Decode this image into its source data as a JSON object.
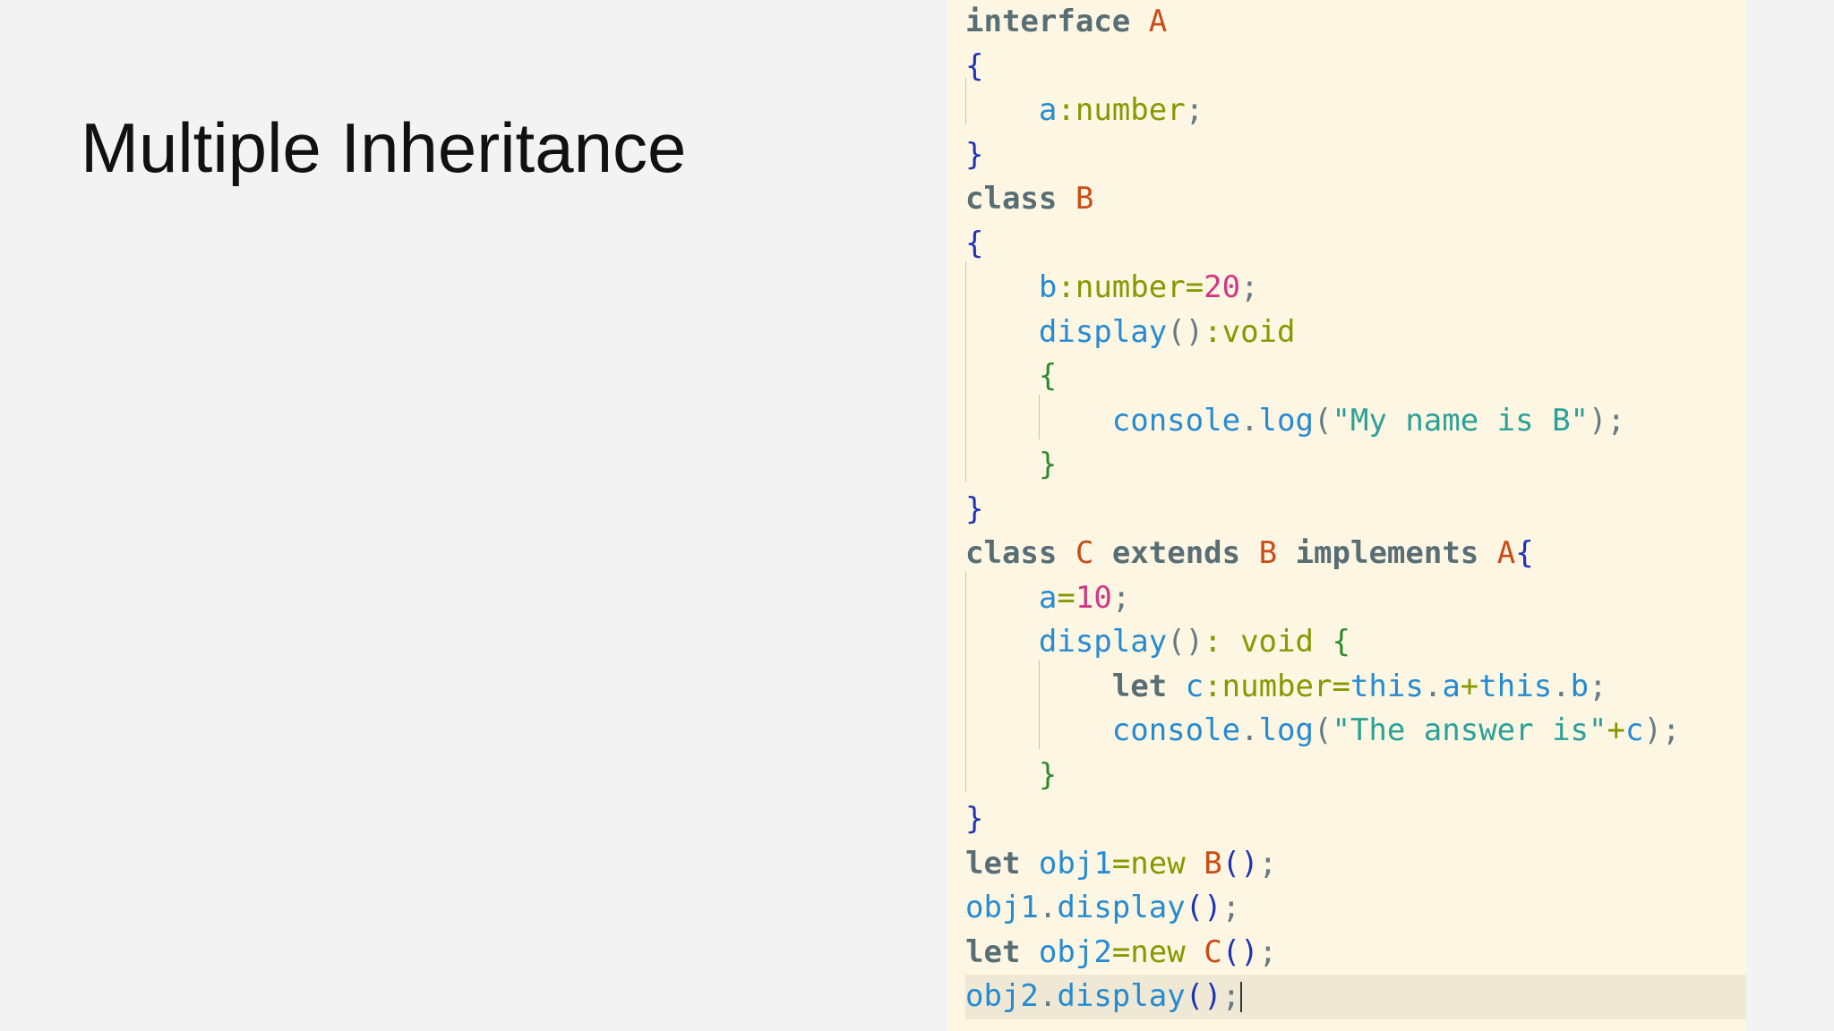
{
  "slide": {
    "title": "Multiple Inheritance"
  },
  "colors": {
    "slide_background": "#f3f3f3",
    "editor_background": "#fdf6e3",
    "current_line_background": "#efe8d4",
    "keyword": "#586e75",
    "type": "#859900",
    "identifier_name": "#cb4b16",
    "brace": "#2033b8",
    "inner_brace": "#2e8b2e",
    "property": "#268bd2",
    "number": "#d33682",
    "string": "#2aa198"
  },
  "editor": {
    "current_line": 23,
    "lines": [
      [
        [
          "kw",
          "interface"
        ],
        [
          "pu",
          " "
        ],
        [
          "nm",
          "A"
        ]
      ],
      [
        [
          "br",
          "{"
        ]
      ],
      [
        [
          "pu",
          "    "
        ],
        [
          "pr",
          "a"
        ],
        [
          "ty",
          ":number"
        ],
        [
          "pu",
          ";"
        ]
      ],
      [
        [
          "br",
          "}"
        ]
      ],
      [
        [
          "kw",
          "class"
        ],
        [
          "pu",
          " "
        ],
        [
          "nm",
          "B"
        ]
      ],
      [
        [
          "br",
          "{"
        ]
      ],
      [
        [
          "pu",
          "    "
        ],
        [
          "pr",
          "b"
        ],
        [
          "ty",
          ":number"
        ],
        [
          "op",
          "="
        ],
        [
          "num",
          "20"
        ],
        [
          "pu",
          ";"
        ]
      ],
      [
        [
          "pu",
          "    "
        ],
        [
          "fn",
          "display"
        ],
        [
          "pu",
          "()"
        ],
        [
          "ty",
          ":void"
        ]
      ],
      [
        [
          "pu",
          "    "
        ],
        [
          "br2",
          "{"
        ]
      ],
      [
        [
          "pu",
          "        "
        ],
        [
          "fn",
          "console"
        ],
        [
          "pu",
          "."
        ],
        [
          "fn",
          "log"
        ],
        [
          "pu",
          "("
        ],
        [
          "str",
          "\"My name is B\""
        ],
        [
          "pu",
          ");"
        ]
      ],
      [
        [
          "pu",
          "    "
        ],
        [
          "br2",
          "}"
        ]
      ],
      [
        [
          "br",
          "}"
        ]
      ],
      [
        [
          "kw",
          "class"
        ],
        [
          "pu",
          " "
        ],
        [
          "nm",
          "C"
        ],
        [
          "pu",
          " "
        ],
        [
          "kw",
          "extends"
        ],
        [
          "pu",
          " "
        ],
        [
          "nm",
          "B"
        ],
        [
          "pu",
          " "
        ],
        [
          "kw",
          "implements"
        ],
        [
          "pu",
          " "
        ],
        [
          "nm",
          "A"
        ],
        [
          "br",
          "{"
        ]
      ],
      [
        [
          "pu",
          "    "
        ],
        [
          "pr",
          "a"
        ],
        [
          "op",
          "="
        ],
        [
          "num",
          "10"
        ],
        [
          "pu",
          ";"
        ]
      ],
      [
        [
          "pu",
          "    "
        ],
        [
          "fn",
          "display"
        ],
        [
          "pu",
          "()"
        ],
        [
          "ty",
          ": void"
        ],
        [
          "pu",
          " "
        ],
        [
          "br2",
          "{"
        ]
      ],
      [
        [
          "pu",
          "        "
        ],
        [
          "kw",
          "let"
        ],
        [
          "pu",
          " "
        ],
        [
          "pr",
          "c"
        ],
        [
          "ty",
          ":number"
        ],
        [
          "op",
          "="
        ],
        [
          "fn",
          "this"
        ],
        [
          "pu",
          "."
        ],
        [
          "pr",
          "a"
        ],
        [
          "op",
          "+"
        ],
        [
          "fn",
          "this"
        ],
        [
          "pu",
          "."
        ],
        [
          "pr",
          "b"
        ],
        [
          "pu",
          ";"
        ]
      ],
      [
        [
          "pu",
          "        "
        ],
        [
          "fn",
          "console"
        ],
        [
          "pu",
          "."
        ],
        [
          "fn",
          "log"
        ],
        [
          "pu",
          "("
        ],
        [
          "str",
          "\"The answer is\""
        ],
        [
          "op",
          "+"
        ],
        [
          "pr",
          "c"
        ],
        [
          "pu",
          ");"
        ]
      ],
      [
        [
          "pu",
          "    "
        ],
        [
          "br2",
          "}"
        ]
      ],
      [
        [
          "br",
          "}"
        ]
      ],
      [
        [
          "kw",
          "let"
        ],
        [
          "pu",
          " "
        ],
        [
          "pr",
          "obj1"
        ],
        [
          "op",
          "="
        ],
        [
          "ty",
          "new"
        ],
        [
          "pu",
          " "
        ],
        [
          "nm",
          "B"
        ],
        [
          "br",
          "()"
        ],
        [
          "pu",
          ";"
        ]
      ],
      [
        [
          "pr",
          "obj1"
        ],
        [
          "pu",
          "."
        ],
        [
          "fn",
          "display"
        ],
        [
          "br",
          "()"
        ],
        [
          "pu",
          ";"
        ]
      ],
      [
        [
          "kw",
          "let"
        ],
        [
          "pu",
          " "
        ],
        [
          "pr",
          "obj2"
        ],
        [
          "op",
          "="
        ],
        [
          "ty",
          "new"
        ],
        [
          "pu",
          " "
        ],
        [
          "nm",
          "C"
        ],
        [
          "br",
          "()"
        ],
        [
          "pu",
          ";"
        ]
      ],
      [
        [
          "pr",
          "obj2"
        ],
        [
          "pu",
          "."
        ],
        [
          "fn",
          "display"
        ],
        [
          "br",
          "()"
        ],
        [
          "pu",
          ";"
        ]
      ]
    ]
  }
}
